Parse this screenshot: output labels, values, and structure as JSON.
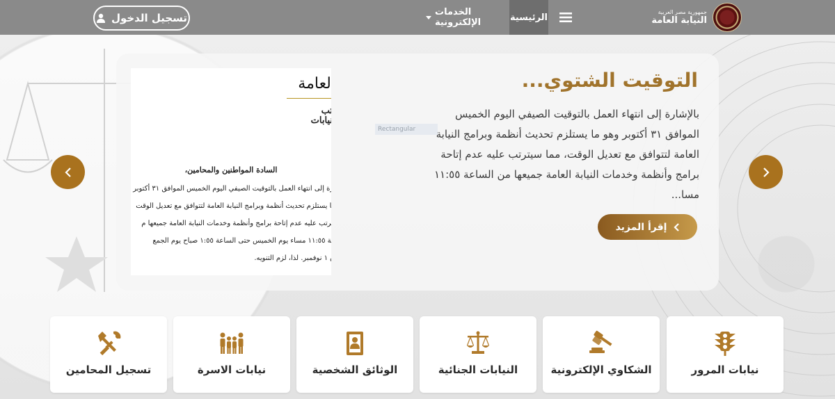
{
  "header": {
    "login_label": "تسجيل الدخول",
    "nav_home": "الرئيسية",
    "nav_services": "الخدمات الإلكترونية",
    "brand_sub": "جمهورية مصر العربية",
    "brand_title": "النيابة العامة"
  },
  "slide": {
    "title": "التوقيت الشتوي...",
    "body": "بالإشارة إلى انتهاء العمل بالتوقيت الصيفي اليوم الخميس الموافق ٣١ أكتوبر وهو ما يستلزم تحديث أنظمة وبرامج النيابة العامة لتتوافق مع تعديل الوقت، مما سيترتب عليه عدم إتاحة برامج وأنظمة وخدمات النيابة العامة جميعها من الساعة ١١:٥٥ مسا...",
    "read_more": "إقرأ المزيد",
    "watermark": "Rectangular",
    "doc": {
      "heading": "العامة",
      "line_a": "تب",
      "line_b": "نيابات",
      "salutation": "السادة المواطنين والمحامين،",
      "lines": [
        "ارة إلى انتهاء العمل بالتوقيت الصيفي اليوم الخميس الموافق ٣١ أكتوبر",
        "ما يستلزم تحديث أنظمة وبرامج النيابة العامة لتتوافق مع تعديل الوقت",
        "يترتب عليه عدم إتاحة برامج وأنظمة وخدمات النيابة العامة جميعها م",
        "عة ١١:٥٥ مساء يوم الخميس حتى الساعة ١:٥٥ صباح يوم الجمع",
        "ق ١ نوفمبر. لذا، لزم التنويه."
      ]
    }
  },
  "tiles": [
    {
      "label": "نيابات المرور",
      "icon": "traffic-light-icon"
    },
    {
      "label": "الشكاوي الإلكترونية",
      "icon": "gavel-icon"
    },
    {
      "label": "النيابات الجنائية",
      "icon": "scales-icon"
    },
    {
      "label": "الوثائق الشخصية",
      "icon": "id-card-icon"
    },
    {
      "label": "نيابات الاسرة",
      "icon": "family-icon"
    },
    {
      "label": "تسجيل المحامين",
      "icon": "tools-icon"
    }
  ],
  "colors": {
    "topbar": "#8a8a8a",
    "accent": "#a0732b",
    "tile_icon": "#b07a2a"
  }
}
